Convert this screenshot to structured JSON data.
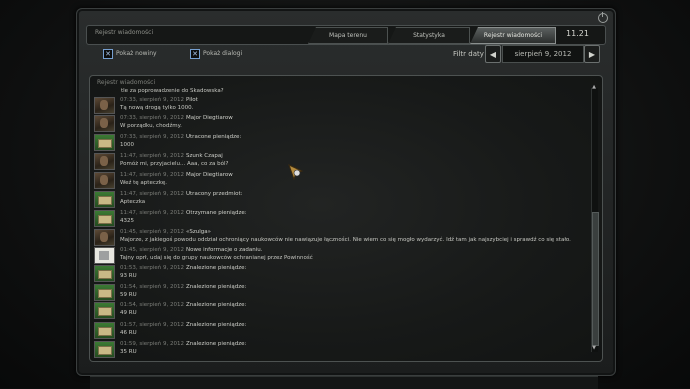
{
  "window": {
    "title": "Rejestr wiadomości",
    "clock": "11.21"
  },
  "tabs": [
    {
      "label": "Mapa terenu"
    },
    {
      "label": "Statystyka"
    },
    {
      "label": "Rejestr wiadomości",
      "active": true
    }
  ],
  "filters": {
    "show_news": {
      "label": "Pokaż nowiny",
      "checked": true
    },
    "show_dialogs": {
      "label": "Pokaż dialogi",
      "checked": true
    },
    "date_filter_label": "Filtr daty",
    "date_value": "sierpień 9, 2012",
    "prev_arrow": "◀",
    "next_arrow": "▶"
  },
  "log": {
    "title": "Rejestr wiadomości",
    "top_line": "tle za poprowadzenie do Skadowska?",
    "messages": [
      {
        "icon": "face",
        "time": "07:33, sierpień 9, 2012",
        "who": "Pilot",
        "text": "Tą nową drogą tylko 1000."
      },
      {
        "icon": "face",
        "time": "07:33, sierpień 9, 2012",
        "who": "Major Diegtiarow",
        "text": "W porządku, chodźmy."
      },
      {
        "icon": "money",
        "time": "07:33, sierpień 9, 2012",
        "who": "Utracone pieniądze:",
        "text": "1000"
      },
      {
        "icon": "face",
        "time": "11:47, sierpień 9, 2012",
        "who": "Szunk Czapaj",
        "text": "Pomóż mi, przyjacielu... Aaa, co za ból?"
      },
      {
        "icon": "face",
        "time": "11:47, sierpień 9, 2012",
        "who": "Major Diegtiarow",
        "text": "Weź tę apteczkę."
      },
      {
        "icon": "money",
        "time": "11:47, sierpień 9, 2012",
        "who": "Utracony przedmiot:",
        "text": "Apteczka"
      },
      {
        "icon": "money",
        "time": "11:47, sierpień 9, 2012",
        "who": "Otrzymane pieniądze:",
        "text": "4325"
      },
      {
        "icon": "face",
        "time": "01:45, sierpień 9, 2012",
        "who": "«Szulga»",
        "text": "Majorze, z jakiegoś powodu oddział ochroniący naukowców nie nawiązuje łączności. Nie wiem co się mogło wydarzyć. Idź tam jak najszybciej i sprawdź co się stało."
      },
      {
        "icon": "note",
        "time": "01:45, sierpień 9, 2012",
        "who": "Nowe informacje o zadaniu.",
        "text": "Tajny oprł, udaj się do grupy naukowców ochranianej przez Powinność"
      },
      {
        "icon": "money",
        "time": "01:53, sierpień 9, 2012",
        "who": "Znalezione pieniądze:",
        "text": "93 RU"
      },
      {
        "icon": "money",
        "time": "01:54, sierpień 9, 2012",
        "who": "Znalezione pieniądze:",
        "text": "59 RU"
      },
      {
        "icon": "money",
        "time": "01:54, sierpień 9, 2012",
        "who": "Znalezione pieniądze:",
        "text": "49 RU"
      },
      {
        "icon": "money",
        "time": "01:57, sierpień 9, 2012",
        "who": "Znalezione pieniądze:",
        "text": "46 RU"
      },
      {
        "icon": "money",
        "time": "01:59, sierpień 9, 2012",
        "who": "Znalezione pieniądze:",
        "text": "35 RU"
      }
    ]
  }
}
